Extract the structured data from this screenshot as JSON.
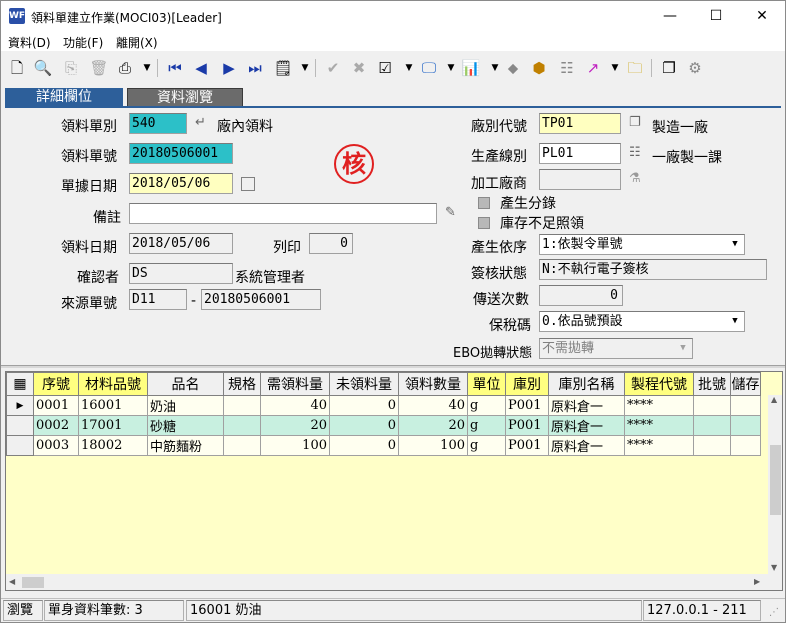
{
  "window": {
    "title": "領料單建立作業(MOCI03)[Leader]",
    "app_icon_text": "WF"
  },
  "menu": {
    "items": [
      "資料(D)",
      "功能(F)",
      "離開(X)"
    ]
  },
  "tabs": {
    "detail": "詳細欄位",
    "browse": "資料瀏覽"
  },
  "form": {
    "doc_type_label": "領料單別",
    "doc_type_value": "540",
    "doc_type_name": "廠內領料",
    "doc_no_label": "領料單號",
    "doc_no_value": "20180506001",
    "doc_date_label": "單據日期",
    "doc_date_value": "2018/05/06",
    "remark_label": "備註",
    "remark_value": "",
    "issue_date_label": "領料日期",
    "issue_date_value": "2018/05/06",
    "print_label": "列印",
    "print_value": "0",
    "confirmer_label": "確認者",
    "confirmer_value": "DS",
    "confirmer_name": "系統管理者",
    "source_label": "來源單號",
    "source_type": "D11",
    "source_dash": "-",
    "source_no": "20180506001",
    "stamp_text": "核",
    "factory_label": "廠別代號",
    "factory_value": "TP01",
    "factory_name": "製造一廠",
    "line_label": "生產線別",
    "line_value": "PL01",
    "line_name": "一廠製一課",
    "vendor_label": "加工廠商",
    "vendor_value": "",
    "gen_split_label": "產生分錄",
    "stock_label": "庫存不足照領",
    "basis_label": "產生依序",
    "basis_value": "1:依製令單號",
    "sign_label": "簽核狀態",
    "sign_value": "N:不執行電子簽核",
    "send_label": "傳送次數",
    "send_value": "0",
    "tax_label": "保稅碼",
    "tax_value": "0.依品號預設",
    "ebo_label": "EBO拋轉狀態",
    "ebo_value": "不需拋轉"
  },
  "grid": {
    "columns": [
      "序號",
      "材料品號",
      "品名",
      "規格",
      "需領料量",
      "未領料量",
      "領料數量",
      "單位",
      "庫別",
      "庫別名稱",
      "製程代號",
      "批號",
      "儲存"
    ],
    "rows": [
      {
        "current": "▶",
        "seq": "0001",
        "item": "16001",
        "name": "奶油",
        "spec": "",
        "req": "40",
        "unissued": "0",
        "qty": "40",
        "unit": "g",
        "wh": "P001",
        "wh_name": "原料倉一",
        "proc": "****",
        "lot": "",
        "store": ""
      },
      {
        "current": "",
        "seq": "0002",
        "item": "17001",
        "name": "砂糖",
        "spec": "",
        "req": "20",
        "unissued": "0",
        "qty": "20",
        "unit": "g",
        "wh": "P001",
        "wh_name": "原料倉一",
        "proc": "****",
        "lot": "",
        "store": ""
      },
      {
        "current": "",
        "seq": "0003",
        "item": "18002",
        "name": "中筋麵粉",
        "spec": "",
        "req": "100",
        "unissued": "0",
        "qty": "100",
        "unit": "g",
        "wh": "P001",
        "wh_name": "原料倉一",
        "proc": "****",
        "lot": "",
        "store": ""
      }
    ]
  },
  "status": {
    "mode": "瀏覽",
    "record_count": "單身資料筆數: 3",
    "current_item": "16001 奶油",
    "server": "127.0.0.1 - 211"
  }
}
